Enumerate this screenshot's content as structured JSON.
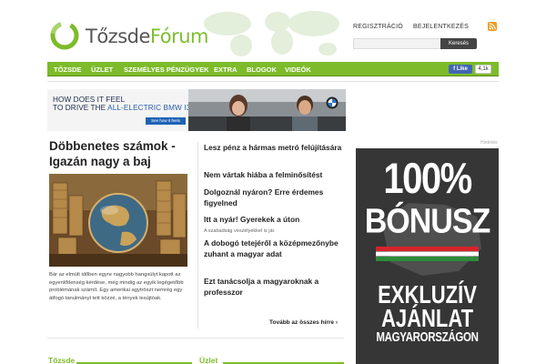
{
  "brand": {
    "name_part1": "Tőzsde",
    "name_part2": "Fórum",
    "accent": "#7dbb2a"
  },
  "header": {
    "register": "REGISZTRÁCIÓ",
    "login": "BEJELENTKEZÉS",
    "rss_icon": "rss-icon",
    "search": {
      "placeholder": "",
      "button": "Keresés"
    }
  },
  "nav": {
    "items": [
      "TŐZSDE",
      "ÜZLET",
      "SZEMÉLYES PÉNZÜGYEK",
      "EXTRA",
      "BLOGOK",
      "VIDEÓK"
    ],
    "fb_like": "Like",
    "fb_count": "4,1k"
  },
  "ad_banner": {
    "line1": "HOW DOES IT FEEL",
    "line2_a": "TO DRIVE THE ",
    "line2_b": "ALL-ELECTRIC BMW i3?",
    "cta": "See how it feels"
  },
  "main_story": {
    "headline": "Döbbenetes számok - Igazán nagy a baj",
    "excerpt": "Bár az elmúlt időben egyre nagyobb hangsúlyt kapott az egyenlőtlenség kérdése, még mindig az egyik legégetőbb problémának számít. Egy amerikai agytröszt nemrég egy átfogó tanulmányt tett közzé, a tények lesújtóak."
  },
  "headlines": [
    {
      "title": "Lesz pénz a hármas metró felújítására",
      "sub": ""
    },
    {
      "title": "Nem vártak hiába a felminősítést",
      "sub": ""
    },
    {
      "title": "Dolgoznál nyáron? Erre érdemes figyelned",
      "sub": ""
    },
    {
      "title": "Itt a nyár! Gyerekek a úton",
      "sub": "A szabadság veszélyekkel is jár."
    },
    {
      "title": "A dobogó tetejéről a középmezőnybe zuhant a magyar adat",
      "sub": ""
    },
    {
      "title": "Ezt tanácsolja a magyaroknak a professzor",
      "sub": ""
    }
  ],
  "more_link": "Tovább az összes hírre",
  "sections": [
    "Tőzsde",
    "Üzlet"
  ],
  "right_ad": {
    "label": "Hirdetés",
    "percent": "100%",
    "bonus": "BÓNUSZ",
    "line1": "EXKLUZÍV",
    "line2": "AJÁNLAT",
    "line3": "MAGYARORSZÁGON"
  }
}
